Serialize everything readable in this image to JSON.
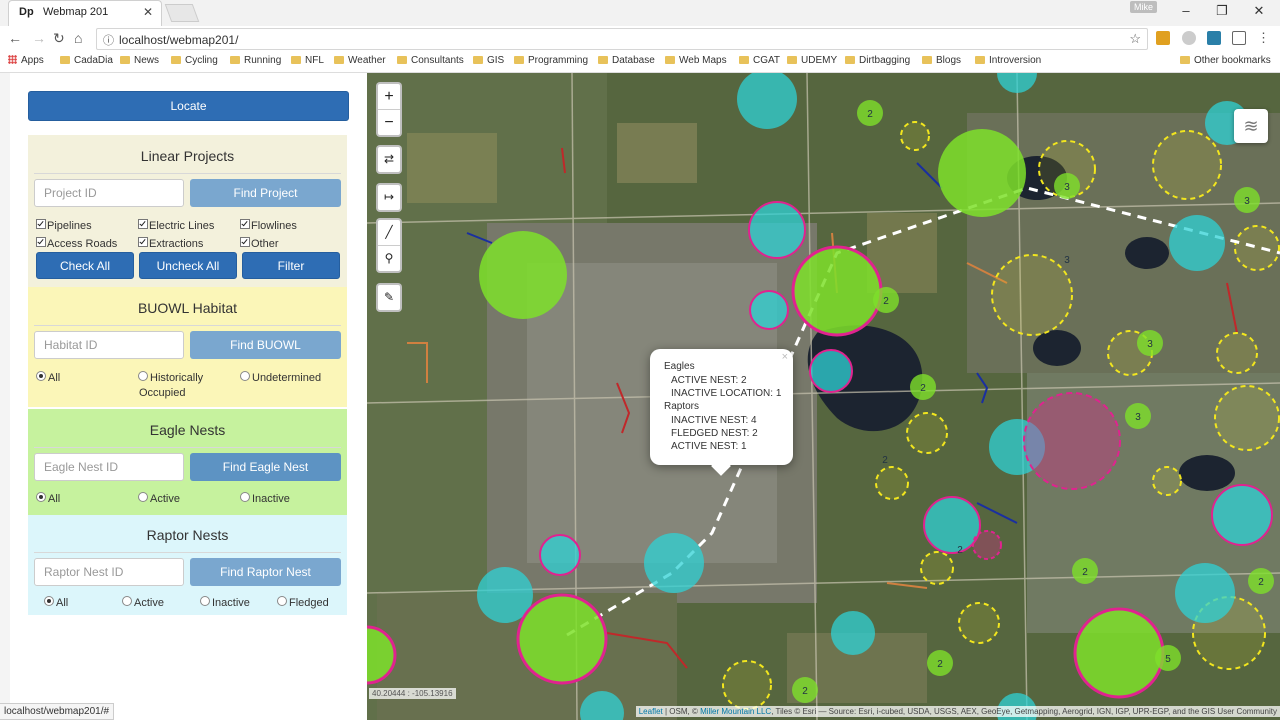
{
  "browser": {
    "tab_title": "Webmap 201",
    "tab_favicon": "Dp",
    "user_label": "Mike",
    "url": "localhost/webmap201/",
    "bookmarks": [
      "Apps",
      "CadaDia",
      "News",
      "Cycling",
      "Running",
      "NFL",
      "Weather",
      "Consultants",
      "GIS",
      "Programming",
      "Database",
      "Web Maps",
      "CGAT",
      "UDEMY",
      "Dirtbagging",
      "Blogs",
      "Introversion"
    ],
    "other_bookmarks": "Other bookmarks",
    "status_url": "localhost/webmap201/#"
  },
  "sidebar": {
    "locate_label": "Locate",
    "linear": {
      "title": "Linear Projects",
      "placeholder": "Project ID",
      "find_label": "Find Project",
      "checkboxes": [
        "Pipelines",
        "Electric Lines",
        "Flowlines",
        "Access Roads",
        "Extractions",
        "Other"
      ],
      "check_all": "Check All",
      "uncheck_all": "Uncheck All",
      "filter": "Filter"
    },
    "buowl": {
      "title": "BUOWL Habitat",
      "placeholder": "Habitat ID",
      "find_label": "Find BUOWL",
      "radios": [
        "All",
        "Historically",
        "Undetermined"
      ],
      "radio_extra": "Occupied"
    },
    "eagle": {
      "title": "Eagle Nests",
      "placeholder": "Eagle Nest ID",
      "find_label": "Find Eagle Nest",
      "radios": [
        "All",
        "Active",
        "Inactive"
      ]
    },
    "raptor": {
      "title": "Raptor Nests",
      "placeholder": "Raptor Nest ID",
      "find_label": "Find Raptor Nest",
      "radios": [
        "All",
        "Active",
        "Inactive",
        "Fledged"
      ]
    }
  },
  "map": {
    "zoom_in": "+",
    "zoom_out": "−",
    "popup": {
      "close": "×",
      "lines": [
        "Eagles",
        "ACTIVE NEST: 2",
        "INACTIVE LOCATION: 1",
        "Raptors",
        "INACTIVE NEST: 4",
        "FLEDGED NEST: 2",
        "ACTIVE NEST: 1"
      ]
    },
    "coords": "40.20444 : -105.13916",
    "attribution_leaflet": "Leaflet",
    "attribution_osm": " | OSM, © ",
    "attribution_mm": "Miller Mountain LLC",
    "attribution_rest": ", Tiles © Esri — Source: Esri, i-cubed, USDA, USGS, AEX, GeoEye, Getmapping, Aerogrid, IGN, IGP, UPR-EGP, and the GIS User Community",
    "cluster_labels": [
      "2",
      "2",
      "3",
      "2",
      "2",
      "3",
      "3",
      "2",
      "3",
      "3",
      "2",
      "2",
      "5",
      "2",
      "2"
    ],
    "colors": {
      "eagle_green": "#7ee02a",
      "raptor_cyan": "#2fd1d6",
      "buowl_yellow": "#f2e61e",
      "magenta_border": "#e0238f",
      "linear_orange": "#d08040"
    }
  }
}
